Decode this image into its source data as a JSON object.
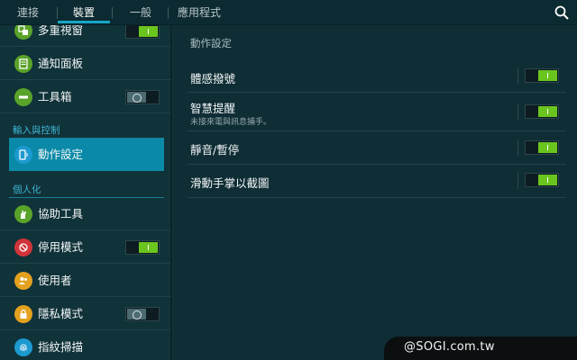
{
  "tabs": [
    {
      "label": "連接",
      "active": false
    },
    {
      "label": "裝置",
      "active": true
    },
    {
      "label": "一般",
      "active": false
    },
    {
      "label": "應用程式",
      "active": false
    }
  ],
  "search_icon": "search-icon",
  "sidebar": {
    "items": [
      {
        "label": "多重視窗",
        "icon": "multi-window-icon",
        "icon_color": "#5aa32a",
        "toggle": "on"
      },
      {
        "label": "通知面板",
        "icon": "notification-panel-icon",
        "icon_color": "#5aa32a",
        "toggle": null
      },
      {
        "label": "工具箱",
        "icon": "toolbox-icon",
        "icon_color": "#5aa32a",
        "toggle": "off"
      },
      {
        "label": "動作設定",
        "icon": "motion-icon",
        "icon_color": "#1d9ad0",
        "toggle": null,
        "selected": true
      },
      {
        "label": "協助工具",
        "icon": "accessibility-icon",
        "icon_color": "#5aa32a",
        "toggle": null
      },
      {
        "label": "停用模式",
        "icon": "blocking-mode-icon",
        "icon_color": "#d0343a",
        "toggle": "on"
      },
      {
        "label": "使用者",
        "icon": "users-icon",
        "icon_color": "#e3a11f",
        "toggle": null
      },
      {
        "label": "隱私模式",
        "icon": "private-mode-icon",
        "icon_color": "#e3a11f",
        "toggle": "off"
      },
      {
        "label": "指紋掃描",
        "icon": "fingerprint-icon",
        "icon_color": "#1d9ad0",
        "toggle": null
      }
    ],
    "sections": {
      "input_control": "輸入與控制",
      "personalization": "個人化"
    }
  },
  "panel": {
    "title": "動作設定",
    "rows": [
      {
        "title": "體感撥號",
        "subtitle": "",
        "toggle": "on"
      },
      {
        "title": "智慧提醒",
        "subtitle": "未接來電與訊息捕手。",
        "toggle": "on"
      },
      {
        "title": "靜音/暫停",
        "subtitle": "",
        "toggle": "on"
      },
      {
        "title": "滑動手掌以截圖",
        "subtitle": "",
        "toggle": "on"
      }
    ]
  },
  "watermark": "@SOGI.com.tw",
  "colors": {
    "accent": "#16a7c6",
    "selected_bg": "#0a8aa8",
    "toggle_on": "#6ac51f",
    "section_text": "#3eb3d0"
  }
}
